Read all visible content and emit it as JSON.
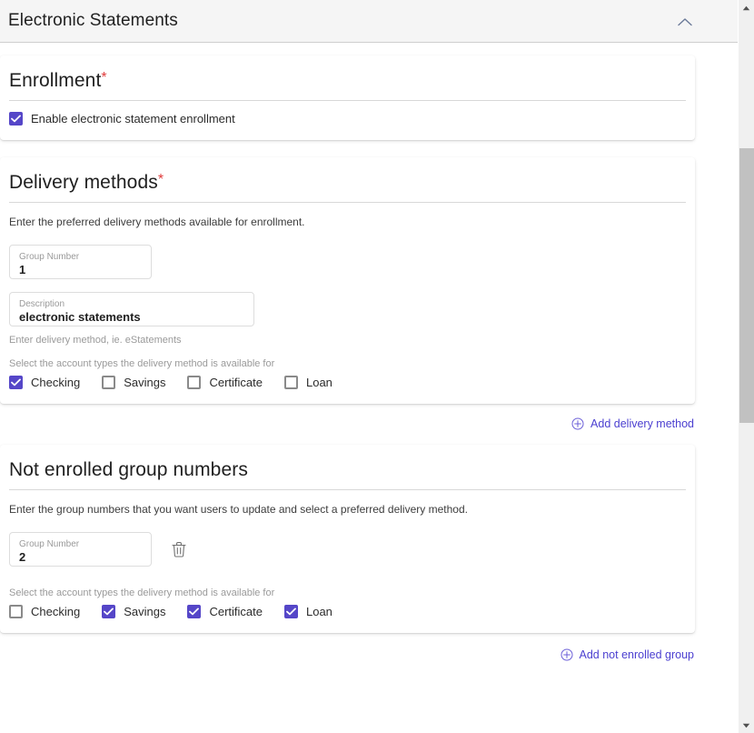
{
  "panel": {
    "title": "Electronic Statements",
    "collapse_icon": "chevron-up-icon"
  },
  "enrollment": {
    "title": "Enrollment",
    "required_marker": "*",
    "checkbox": {
      "label": "Enable electronic statement enrollment",
      "checked": true
    }
  },
  "delivery_methods": {
    "title": "Delivery methods",
    "required_marker": "*",
    "description": "Enter the preferred delivery methods available for enrollment.",
    "group_number_field": {
      "label": "Group Number",
      "value": "1"
    },
    "description_field": {
      "label": "Description",
      "value": "electronic statements"
    },
    "description_helper": "Enter delivery method, ie. eStatements",
    "account_types_helper": "Select the account types the delivery method is available for",
    "account_types": [
      {
        "label": "Checking",
        "checked": true
      },
      {
        "label": "Savings",
        "checked": false
      },
      {
        "label": "Certificate",
        "checked": false
      },
      {
        "label": "Loan",
        "checked": false
      }
    ],
    "add_link": {
      "label": "Add delivery method",
      "icon": "plus-circle-icon"
    }
  },
  "not_enrolled": {
    "title": "Not enrolled group numbers",
    "description": "Enter the group numbers that you want users to update and select a preferred delivery method.",
    "group_number_field": {
      "label": "Group Number",
      "value": "2"
    },
    "delete_icon": "trash-icon",
    "account_types_helper": "Select the account types the delivery method is available for",
    "account_types": [
      {
        "label": "Checking",
        "checked": false
      },
      {
        "label": "Savings",
        "checked": true
      },
      {
        "label": "Certificate",
        "checked": true
      },
      {
        "label": "Loan",
        "checked": true
      }
    ],
    "add_link": {
      "label": "Add not enrolled group",
      "icon": "plus-circle-icon"
    }
  },
  "scrollbar": {
    "up_icon": "scroll-up-arrow-icon",
    "down_icon": "scroll-down-arrow-icon"
  },
  "colors": {
    "accent_purple": "#5546c8",
    "link_purple": "#4b3fd0",
    "required_red": "#e03c3c",
    "header_bg": "#f5f5f5"
  }
}
